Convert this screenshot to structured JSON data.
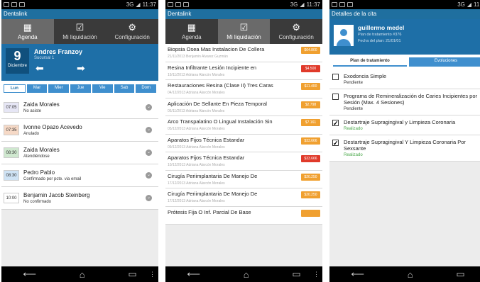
{
  "status": {
    "clock1": "11:37",
    "clock2": "11:37",
    "clock3": "11:4",
    "network": "3G"
  },
  "screen1": {
    "app_title": "Dentalink",
    "tabs": [
      {
        "label": "Agenda",
        "icon": "calendar-icon"
      },
      {
        "label": "Mi liquidación",
        "icon": "checkbox-icon"
      },
      {
        "label": "Configuración",
        "icon": "gear-icon"
      }
    ],
    "day": "9",
    "month": "Diciembre",
    "doctor": "Andres Franzoy",
    "branch": "Sucursal 1",
    "weekdays": [
      "Lun",
      "Mar",
      "Mier",
      "Jue",
      "Vie",
      "Sab",
      "Dom"
    ],
    "appointments": [
      {
        "time": "07:05",
        "name": "Zaida Morales",
        "status": "No asiste",
        "color": "#e6e6f5"
      },
      {
        "time": "07:35",
        "name": "Ivonne Opazo Acevedo",
        "status": "Anulado",
        "color": "#f6d9c6"
      },
      {
        "time": "08:30",
        "name": "Zaida Morales",
        "status": "Atendiéndose",
        "color": "#cfe8cf"
      },
      {
        "time": "08:30",
        "name": "Pedro Pablo",
        "status": "Confirmado por pcte. via email",
        "color": "#cfe3f5"
      },
      {
        "time": "10:00",
        "name": "Benjamin Jacob Steinberg",
        "status": "No confirmado",
        "color": "#ffffff"
      }
    ]
  },
  "screen2": {
    "app_title": "Dentalink",
    "tabs": [
      {
        "label": "Agenda",
        "icon": "calendar-icon"
      },
      {
        "label": "Mi liquidación",
        "icon": "checkbox-icon"
      },
      {
        "label": "Configuración",
        "icon": "gear-icon"
      }
    ],
    "items": [
      {
        "title": "Biopsia Osea Mas Instalacion De Collera",
        "sub": "21/11/2013 Benjamin Alvarez Guzmán",
        "amount": "$64.800",
        "color": "#f0a030"
      },
      {
        "title": "Resina Infiltrante Lesión Incipiente en",
        "sub": "19/11/2013 Adriana Alarcón Morales",
        "amount": "$4.500",
        "color": "#e03a2a"
      },
      {
        "title": "Restauraciones Resina (Clase II) Tres Caras",
        "sub": "04/12/2013 Adriana Alarcón Morales",
        "amount": "$11.400",
        "color": "#f0a030"
      },
      {
        "title": "Aplicación De Sellante En Pieza Temporal",
        "sub": "05/11/2013 Adriana Alarcón Morales",
        "amount": "$2.798",
        "color": "#f0a030"
      },
      {
        "title": "Arco Transpalatino O Lingual Instalación Sin",
        "sub": "05/12/2013 Adriana Alarcón Morales",
        "amount": "$7.161",
        "color": "#f0a030"
      },
      {
        "title": "Aparatos Fijos Técnica Estandar",
        "sub": "09/12/2013 Adriana Alarcón Morales",
        "amount": "$33.666",
        "color": "#f0a030"
      },
      {
        "title": "Aparatos Fijos Técnica Estandar",
        "sub": "10/12/2013 Adriana Alarcón Morales",
        "amount": "$33.666",
        "color": "#e03a2a"
      },
      {
        "title": "Cirugía Periimplantaria De Manejo De",
        "sub": "17/12/2013 Adriana Alarcón Morales",
        "amount": "$20.250",
        "color": "#f0a030"
      },
      {
        "title": "Cirugía Periimplantaria De Manejo De",
        "sub": "17/12/2013 Adriana Alarcón Morales",
        "amount": "$20.250",
        "color": "#f0a030"
      },
      {
        "title": "Prótesis Fija O Inf. Parcial De Base",
        "sub": "",
        "amount": "",
        "color": "#f0a030"
      }
    ]
  },
  "screen3": {
    "app_title": "Detalles de la cita",
    "patient": "guillermo medel",
    "plan": "Plan de tratamiento #376",
    "plan_date": "Fecha del plan: 21/01/01",
    "tabs": [
      "Plan de tratamiento",
      "Evoluciones"
    ],
    "treatments": [
      {
        "title": "Exodoncia Simple",
        "status": "Pendiente",
        "checked": false
      },
      {
        "title": "Programa de Remineralización de Caries Incipientes por Sesión (Max. 4 Sesiones)",
        "status": "Pendiente",
        "checked": false
      },
      {
        "title": "Destartraje Supragingival y Limpieza Coronaria",
        "status": "Realizado",
        "checked": true
      },
      {
        "title": "Destartraje Supragingival Y Limpieza Coronaria Por Sexsante",
        "status": "Realizado",
        "checked": true
      }
    ]
  }
}
